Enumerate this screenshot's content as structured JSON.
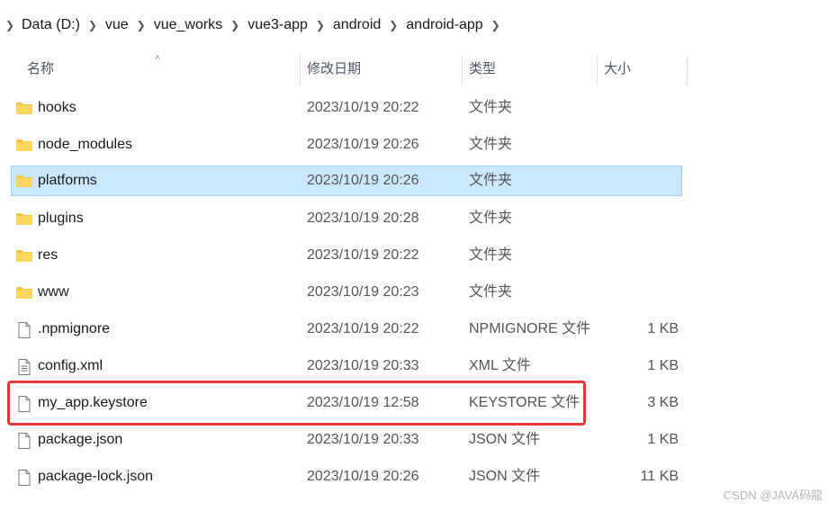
{
  "breadcrumb": [
    "Data (D:)",
    "vue",
    "vue_works",
    "vue3-app",
    "android",
    "android-app"
  ],
  "columns": {
    "name": "名称",
    "date": "修改日期",
    "type": "类型",
    "size": "大小"
  },
  "files": [
    {
      "name": "hooks",
      "date": "2023/10/19 20:22",
      "type": "文件夹",
      "size": "",
      "icon": "folder-icon"
    },
    {
      "name": "node_modules",
      "date": "2023/10/19 20:26",
      "type": "文件夹",
      "size": "",
      "icon": "folder-icon"
    },
    {
      "name": "platforms",
      "date": "2023/10/19 20:26",
      "type": "文件夹",
      "size": "",
      "icon": "folder-icon",
      "selected": true
    },
    {
      "name": "plugins",
      "date": "2023/10/19 20:28",
      "type": "文件夹",
      "size": "",
      "icon": "folder-icon"
    },
    {
      "name": "res",
      "date": "2023/10/19 20:22",
      "type": "文件夹",
      "size": "",
      "icon": "folder-icon"
    },
    {
      "name": "www",
      "date": "2023/10/19 20:23",
      "type": "文件夹",
      "size": "",
      "icon": "folder-icon"
    },
    {
      "name": ".npmignore",
      "date": "2023/10/19 20:22",
      "type": "NPMIGNORE 文件",
      "size": "1 KB",
      "icon": "file-icon"
    },
    {
      "name": "config.xml",
      "date": "2023/10/19 20:33",
      "type": "XML 文件",
      "size": "1 KB",
      "icon": "xml-file-icon"
    },
    {
      "name": "my_app.keystore",
      "date": "2023/10/19 12:58",
      "type": "KEYSTORE 文件",
      "size": "3 KB",
      "icon": "file-icon",
      "highlighted": true
    },
    {
      "name": "package.json",
      "date": "2023/10/19 20:33",
      "type": "JSON 文件",
      "size": "1 KB",
      "icon": "file-icon"
    },
    {
      "name": "package-lock.json",
      "date": "2023/10/19 20:26",
      "type": "JSON 文件",
      "size": "11 KB",
      "icon": "file-icon"
    }
  ],
  "watermark": "CSDN @JAVA码龍",
  "colors": {
    "selection": "#cce8ff",
    "selection_border": "#99d1ff",
    "highlight": "#e53935",
    "folder": "#f5c542"
  }
}
